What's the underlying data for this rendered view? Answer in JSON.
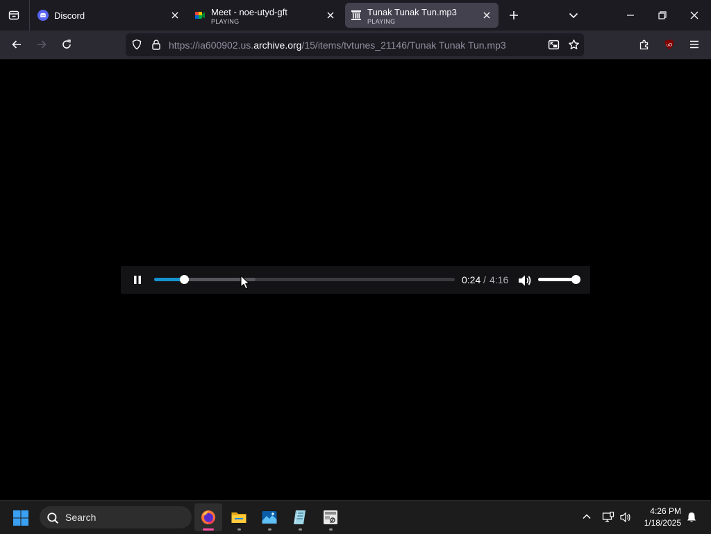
{
  "tabs": [
    {
      "title": "Discord",
      "subtitle": ""
    },
    {
      "title": "Meet - noe-utyd-gft",
      "subtitle": "PLAYING"
    },
    {
      "title": "Tunak Tunak Tun.mp3",
      "subtitle": "PLAYING"
    }
  ],
  "url": {
    "prefix": "https://ia600902.us.",
    "domain": "archive.org",
    "path": "/15/items/tvtunes_21146/Tunak Tunak Tun.mp3"
  },
  "player": {
    "state": "playing",
    "current_time": "0:24",
    "separator": "/",
    "total_time": "4:16",
    "progress_fraction": 0.0987,
    "buffered_fraction": 0.338,
    "volume_fraction": 1.0
  },
  "taskbar": {
    "search_label": "Search",
    "time": "4:26 PM",
    "date": "1/18/2025",
    "apps": [
      "firefox-icon",
      "file-explorer-icon",
      "photos-icon",
      "notepad-icon",
      "snipping-tool-icon"
    ]
  },
  "colors": {
    "accent": "#1593cf",
    "tab_bar": "#1c1b22",
    "nav_bar": "#2b2a33",
    "discord": "#5865f2"
  }
}
